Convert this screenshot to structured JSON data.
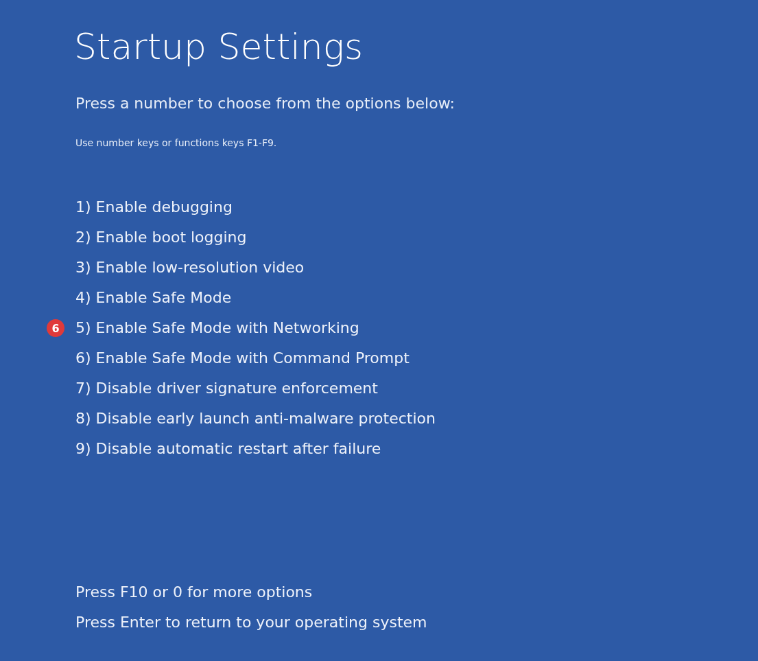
{
  "title": "Startup Settings",
  "subtitle": "Press a number to choose from the options below:",
  "hint": "Use number keys or functions keys F1-F9.",
  "options": [
    {
      "label": "1) Enable debugging"
    },
    {
      "label": "2) Enable boot logging"
    },
    {
      "label": "3) Enable low-resolution video"
    },
    {
      "label": "4) Enable Safe Mode"
    },
    {
      "label": "5) Enable Safe Mode with Networking",
      "badge": "6"
    },
    {
      "label": "6) Enable Safe Mode with Command Prompt"
    },
    {
      "label": "7) Disable driver signature enforcement"
    },
    {
      "label": "8) Disable early launch anti-malware protection"
    },
    {
      "label": "9) Disable automatic restart after failure"
    }
  ],
  "footer": [
    "Press F10 or 0 for more options",
    "Press Enter to return to your operating system"
  ]
}
